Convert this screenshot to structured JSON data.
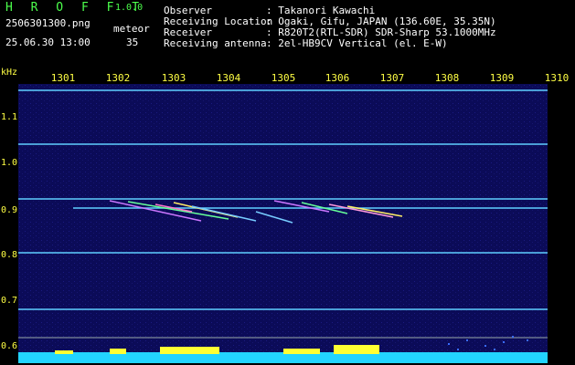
{
  "header": {
    "app_name": "H R O F F T",
    "version": "1.0.0",
    "filename": "2506301300.png",
    "datetime": "25.06.30 13:00",
    "category_label": "meteor",
    "count": "35"
  },
  "info": [
    {
      "label": "Observer",
      "value": ": Takanori Kawachi"
    },
    {
      "label": "Receiving Location",
      "value": ": Ogaki, Gifu, JAPAN (136.60E, 35.35N)"
    },
    {
      "label": "Receiver",
      "value": ": R820T2(RTL-SDR) SDR-Sharp 53.1000MHz"
    },
    {
      "label": "Receiving antenna",
      "value": ": 2el-HB9CV Vertical (el. E-W)"
    }
  ],
  "axes": {
    "x_ticks": [
      "1301",
      "1302",
      "1303",
      "1304",
      "1305",
      "1306",
      "1307",
      "1308",
      "1309",
      "1310"
    ],
    "y_unit": "kHz",
    "y_ticks": [
      "1.1",
      "1.0",
      "0.9",
      "0.8",
      "0.7",
      "0.6"
    ]
  },
  "colors": {
    "text": "#ffffff",
    "accent": "#4cff4c",
    "axis": "#ffff44",
    "spectrum_bg": "#0a0a55",
    "trace_line": "#5fd0ff",
    "noise_floor": "#22d4ff",
    "power_bars": "#ffff33"
  }
}
